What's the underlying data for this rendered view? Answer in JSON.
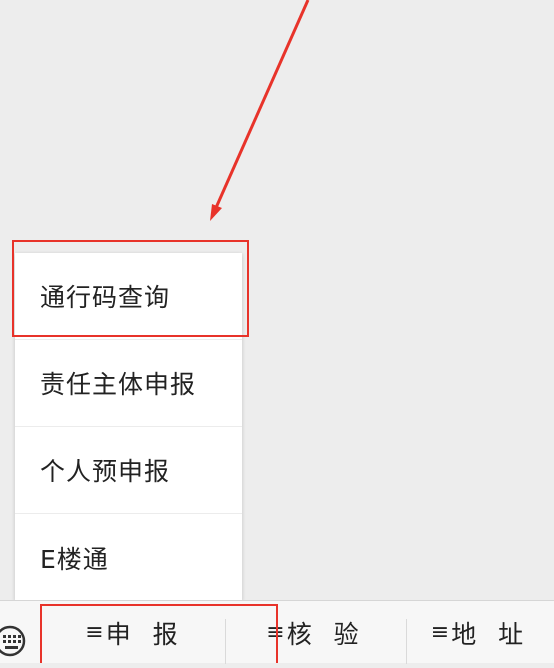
{
  "popup_menu": {
    "items": [
      {
        "label": "通行码查询"
      },
      {
        "label": "责任主体申报"
      },
      {
        "label": "个人预申报"
      },
      {
        "label": "E楼通"
      }
    ]
  },
  "bottom_menu": {
    "keyboard_icon": "keyboard-icon",
    "tabs": [
      {
        "label": "申 报",
        "icon": "≡"
      },
      {
        "label": "核 验",
        "icon": "≡"
      },
      {
        "label": "地 址",
        "icon": "≡"
      }
    ]
  },
  "annotations": {
    "highlight_color": "#e8332a",
    "arrow_color": "#e8332a"
  }
}
